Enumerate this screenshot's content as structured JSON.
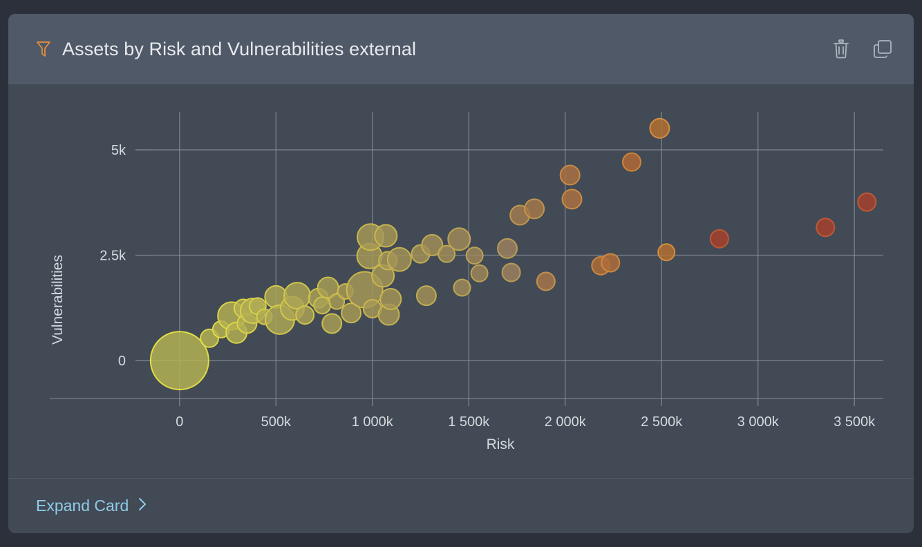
{
  "card": {
    "title": "Assets by Risk and Vulnerabilities external",
    "filter_icon": "filter-funnel-icon",
    "actions": [
      {
        "name": "delete-card-button",
        "icon": "trash-icon",
        "label": "Delete"
      },
      {
        "name": "duplicate-card-button",
        "icon": "copy-icon",
        "label": "Duplicate"
      }
    ],
    "footer": {
      "expand_label": "Expand Card",
      "chevron_icon": "chevron-right-icon"
    }
  },
  "colors": {
    "page_background": "#2b303a",
    "card_background": "#424a56",
    "header_background": "#505967",
    "title_text": "#e8eaed",
    "accent_filter": "#e8913c",
    "link_text": "#8fcbe8",
    "gridline": "#8d949d",
    "axis_text": "#d6dade",
    "bubble_low": "#b5b452",
    "bubble_low_stroke": "#e8e345",
    "bubble_mid": "#a89a55",
    "bubble_mid_stroke": "#d8b942",
    "bubble_high": "#b5702f",
    "bubble_high_stroke": "#d89040",
    "bubble_max": "#a8412c",
    "bubble_max_stroke": "#c05b35"
  },
  "chart_data": {
    "type": "scatter",
    "title": "Assets by Risk and Vulnerabilities external",
    "xlabel": "Risk",
    "ylabel": "Vulnerabilities",
    "xlim": [
      -150000,
      3650000
    ],
    "ylim": [
      -900,
      5900
    ],
    "xticks": [
      0,
      500000,
      1000000,
      1500000,
      2000000,
      2500000,
      3000000,
      3500000
    ],
    "xticklabels": [
      "0",
      "500k",
      "1 000k",
      "1 500k",
      "2 000k",
      "2 500k",
      "3 000k",
      "3 500k"
    ],
    "yticks": [
      0,
      2500,
      5000
    ],
    "yticklabels": [
      "0",
      "2.5k",
      "5k"
    ],
    "grid": true,
    "legend": "none",
    "size_encoding": "bubble radius = asset count",
    "color_encoding": "bubble color = risk (yellow low to red high)",
    "points": [
      {
        "x": 0,
        "y": 0,
        "r": 42,
        "color": "#b5b452",
        "stroke": "#e8e345"
      },
      {
        "x": 155000,
        "y": 530,
        "r": 13,
        "color": "#b7b352",
        "stroke": "#e3dd47"
      },
      {
        "x": 215000,
        "y": 740,
        "r": 12,
        "color": "#b7b352",
        "stroke": "#e3dd47"
      },
      {
        "x": 270000,
        "y": 1060,
        "r": 20,
        "color": "#b5b152",
        "stroke": "#e0d948"
      },
      {
        "x": 295000,
        "y": 660,
        "r": 15,
        "color": "#b5b152",
        "stroke": "#e0d948"
      },
      {
        "x": 330000,
        "y": 1240,
        "r": 13,
        "color": "#b3af53",
        "stroke": "#ddd549"
      },
      {
        "x": 350000,
        "y": 880,
        "r": 14,
        "color": "#b3af53",
        "stroke": "#ddd549"
      },
      {
        "x": 380000,
        "y": 1180,
        "r": 18,
        "color": "#b2ad54",
        "stroke": "#dbd249"
      },
      {
        "x": 405000,
        "y": 1290,
        "r": 12,
        "color": "#b2ad54",
        "stroke": "#dbd249"
      },
      {
        "x": 440000,
        "y": 1040,
        "r": 11,
        "color": "#b0ab54",
        "stroke": "#d9cf4a"
      },
      {
        "x": 500000,
        "y": 1510,
        "r": 16,
        "color": "#aea855",
        "stroke": "#d7cc4a"
      },
      {
        "x": 520000,
        "y": 970,
        "r": 21,
        "color": "#aea855",
        "stroke": "#d7cc4a"
      },
      {
        "x": 585000,
        "y": 1240,
        "r": 17,
        "color": "#ada655",
        "stroke": "#d5c94b"
      },
      {
        "x": 610000,
        "y": 1540,
        "r": 19,
        "color": "#ada655",
        "stroke": "#d5c94b"
      },
      {
        "x": 650000,
        "y": 1080,
        "r": 13,
        "color": "#aca455",
        "stroke": "#d4c74b"
      },
      {
        "x": 720000,
        "y": 1480,
        "r": 14,
        "color": "#aba255",
        "stroke": "#d2c44c"
      },
      {
        "x": 740000,
        "y": 1310,
        "r": 12,
        "color": "#aba255",
        "stroke": "#d2c44c"
      },
      {
        "x": 770000,
        "y": 1730,
        "r": 15,
        "color": "#aaa056",
        "stroke": "#d1c24c"
      },
      {
        "x": 790000,
        "y": 880,
        "r": 14,
        "color": "#aaa056",
        "stroke": "#d1c24c"
      },
      {
        "x": 815000,
        "y": 1400,
        "r": 11,
        "color": "#a99e56",
        "stroke": "#cfbf4d"
      },
      {
        "x": 860000,
        "y": 1640,
        "r": 11,
        "color": "#a89c56",
        "stroke": "#cebd4d"
      },
      {
        "x": 890000,
        "y": 1130,
        "r": 14,
        "color": "#a89c56",
        "stroke": "#cebd4d"
      },
      {
        "x": 960000,
        "y": 1680,
        "r": 26,
        "color": "#a79a57",
        "stroke": "#cdba4d"
      },
      {
        "x": 985000,
        "y": 2480,
        "r": 18,
        "color": "#a79a57",
        "stroke": "#cdba4d"
      },
      {
        "x": 990000,
        "y": 2930,
        "r": 19,
        "color": "#a79a57",
        "stroke": "#cdba4d"
      },
      {
        "x": 1000000,
        "y": 1230,
        "r": 13,
        "color": "#a69857",
        "stroke": "#cbb84e"
      },
      {
        "x": 1055000,
        "y": 2010,
        "r": 16,
        "color": "#a69857",
        "stroke": "#cbb84e"
      },
      {
        "x": 1070000,
        "y": 2960,
        "r": 16,
        "color": "#a69857",
        "stroke": "#cbb84e"
      },
      {
        "x": 1080000,
        "y": 2370,
        "r": 13,
        "color": "#a59657",
        "stroke": "#cab64e"
      },
      {
        "x": 1085000,
        "y": 1090,
        "r": 15,
        "color": "#a59657",
        "stroke": "#cab64e"
      },
      {
        "x": 1095000,
        "y": 1460,
        "r": 15,
        "color": "#a59657",
        "stroke": "#cab64e"
      },
      {
        "x": 1140000,
        "y": 2400,
        "r": 17,
        "color": "#a49458",
        "stroke": "#c8b34f"
      },
      {
        "x": 1250000,
        "y": 2530,
        "r": 13,
        "color": "#a39158",
        "stroke": "#c6b04f"
      },
      {
        "x": 1280000,
        "y": 1540,
        "r": 14,
        "color": "#a39158",
        "stroke": "#c6b04f"
      },
      {
        "x": 1310000,
        "y": 2740,
        "r": 15,
        "color": "#a28f58",
        "stroke": "#c5ae50"
      },
      {
        "x": 1385000,
        "y": 2530,
        "r": 12,
        "color": "#a18d59",
        "stroke": "#c3ab50"
      },
      {
        "x": 1450000,
        "y": 2880,
        "r": 16,
        "color": "#a08a59",
        "stroke": "#c2a851"
      },
      {
        "x": 1465000,
        "y": 1730,
        "r": 12,
        "color": "#a08a59",
        "stroke": "#c2a851"
      },
      {
        "x": 1530000,
        "y": 2490,
        "r": 12,
        "color": "#9f8859",
        "stroke": "#c0a551"
      },
      {
        "x": 1555000,
        "y": 2070,
        "r": 12,
        "color": "#9f8859",
        "stroke": "#c0a551"
      },
      {
        "x": 1700000,
        "y": 2660,
        "r": 14,
        "color": "#9d8260",
        "stroke": "#be9f55"
      },
      {
        "x": 1720000,
        "y": 2090,
        "r": 13,
        "color": "#9d8260",
        "stroke": "#be9f55"
      },
      {
        "x": 1765000,
        "y": 3450,
        "r": 14,
        "color": "#a47d4e",
        "stroke": "#c49a50"
      },
      {
        "x": 1840000,
        "y": 3600,
        "r": 14,
        "color": "#a6794a",
        "stroke": "#c6964c"
      },
      {
        "x": 1900000,
        "y": 1880,
        "r": 13,
        "color": "#a8764a",
        "stroke": "#c8934c"
      },
      {
        "x": 2025000,
        "y": 4400,
        "r": 14,
        "color": "#ac7140",
        "stroke": "#cc8e44"
      },
      {
        "x": 2035000,
        "y": 3830,
        "r": 14,
        "color": "#ac7140",
        "stroke": "#cc8e44"
      },
      {
        "x": 2185000,
        "y": 2250,
        "r": 13,
        "color": "#b06d3a",
        "stroke": "#d08a3e"
      },
      {
        "x": 2235000,
        "y": 2320,
        "r": 13,
        "color": "#b06d3a",
        "stroke": "#d08a3e"
      },
      {
        "x": 2345000,
        "y": 4710,
        "r": 13,
        "color": "#b46a34",
        "stroke": "#d48739"
      },
      {
        "x": 2490000,
        "y": 5510,
        "r": 14,
        "color": "#b5702f",
        "stroke": "#d89040"
      },
      {
        "x": 2525000,
        "y": 2570,
        "r": 12,
        "color": "#b5702f",
        "stroke": "#d89040"
      },
      {
        "x": 2800000,
        "y": 2890,
        "r": 13,
        "color": "#a8412c",
        "stroke": "#c05b35"
      },
      {
        "x": 3350000,
        "y": 3160,
        "r": 13,
        "color": "#a8412c",
        "stroke": "#c05b35"
      },
      {
        "x": 3565000,
        "y": 3760,
        "r": 13,
        "color": "#a8412c",
        "stroke": "#c05b35"
      }
    ]
  }
}
